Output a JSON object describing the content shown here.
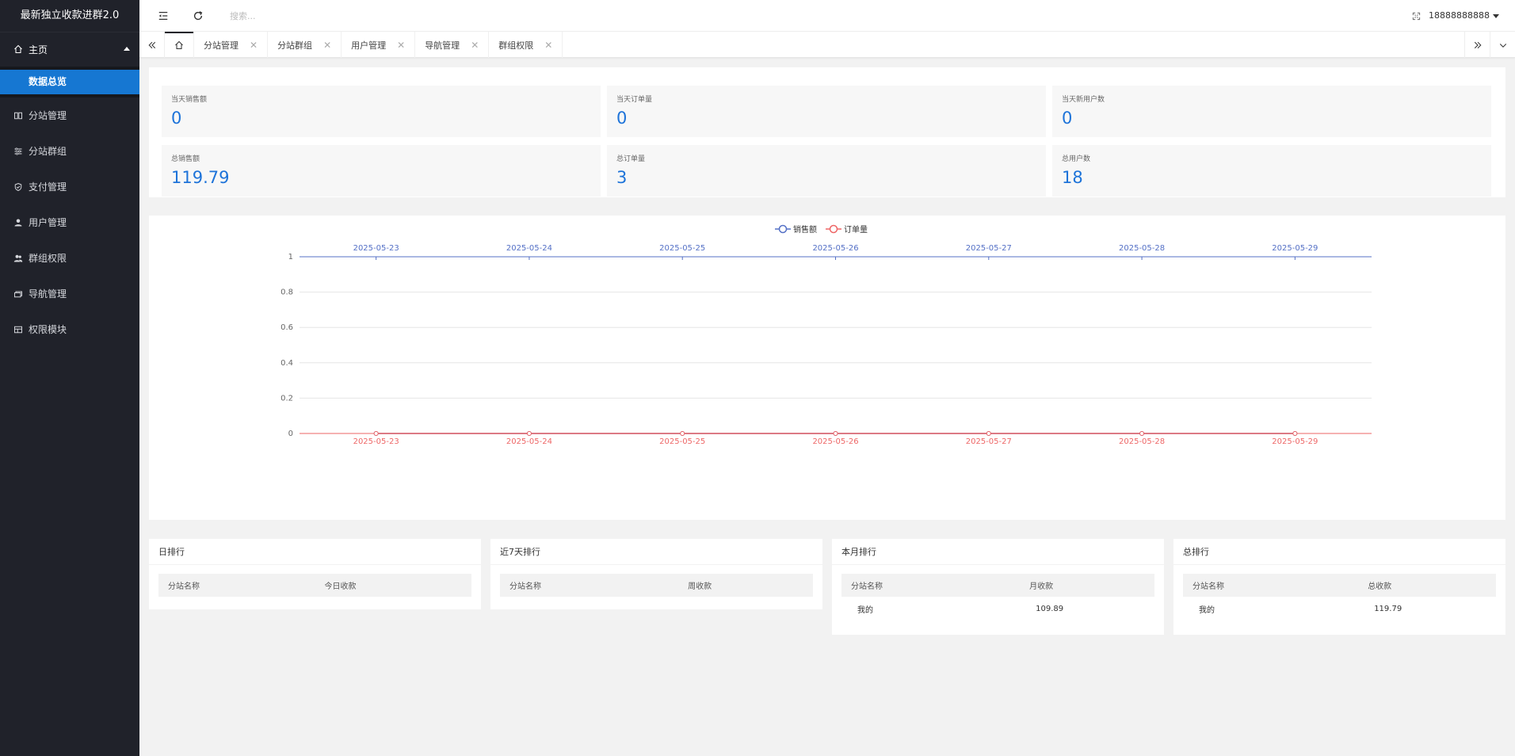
{
  "app": {
    "title": "最新独立收款进群2.0"
  },
  "sidebar": {
    "home": {
      "label": "主页"
    },
    "sub": [
      {
        "label": "数据总览"
      }
    ],
    "items": [
      {
        "label": "分站管理",
        "icon": "columns-icon"
      },
      {
        "label": "分站群组",
        "icon": "sliders-icon"
      },
      {
        "label": "支付管理",
        "icon": "shield-icon"
      },
      {
        "label": "用户管理",
        "icon": "user-icon"
      },
      {
        "label": "群组权限",
        "icon": "users-icon"
      },
      {
        "label": "导航管理",
        "icon": "layers-icon"
      },
      {
        "label": "权限模块",
        "icon": "modules-icon"
      }
    ]
  },
  "header": {
    "search_placeholder": "搜索...",
    "user": "18888888888"
  },
  "tabs": [
    {
      "label": "分站管理"
    },
    {
      "label": "分站群组"
    },
    {
      "label": "用户管理"
    },
    {
      "label": "导航管理"
    },
    {
      "label": "群组权限"
    }
  ],
  "stats": [
    {
      "label": "当天销售额",
      "value": "0"
    },
    {
      "label": "当天订单量",
      "value": "0"
    },
    {
      "label": "当天新用户数",
      "value": "0"
    },
    {
      "label": "总销售额",
      "value": "119.79"
    },
    {
      "label": "总订单量",
      "value": "3"
    },
    {
      "label": "总用户数",
      "value": "18"
    }
  ],
  "chart_data": {
    "type": "line",
    "categories": [
      "2025-05-23",
      "2025-05-24",
      "2025-05-25",
      "2025-05-26",
      "2025-05-27",
      "2025-05-28",
      "2025-05-29"
    ],
    "series": [
      {
        "name": "销售额",
        "values": [
          0,
          0,
          0,
          0,
          0,
          0,
          0
        ],
        "color": "#5470c6"
      },
      {
        "name": "订单量",
        "values": [
          0,
          0,
          0,
          0,
          0,
          0,
          0
        ],
        "color": "#ee6666"
      }
    ],
    "y_ticks": [
      "0",
      "0.2",
      "0.4",
      "0.6",
      "0.8",
      "1"
    ],
    "ylim": [
      0,
      1
    ],
    "grid": true,
    "legend": "top-center"
  },
  "rankings": [
    {
      "title": "日排行",
      "headers": [
        "分站名称",
        "今日收款"
      ],
      "rows": []
    },
    {
      "title": "近7天排行",
      "headers": [
        "分站名称",
        "周收款"
      ],
      "rows": []
    },
    {
      "title": "本月排行",
      "headers": [
        "分站名称",
        "月收款"
      ],
      "rows": [
        [
          "我的",
          "109.89"
        ]
      ]
    },
    {
      "title": "总排行",
      "headers": [
        "分站名称",
        "总收款"
      ],
      "rows": [
        [
          "我的",
          "119.79"
        ]
      ]
    }
  ],
  "colors": {
    "sidebar_bg": "#20222a",
    "accent": "#1677d2",
    "stat_value": "#1d73d9"
  }
}
